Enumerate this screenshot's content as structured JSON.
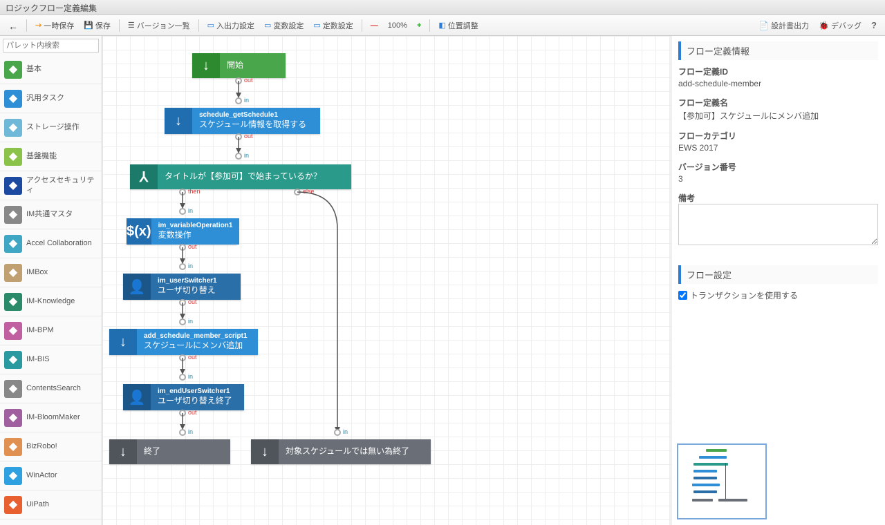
{
  "title": "ロジックフロー定義編集",
  "toolbar": {
    "back": "",
    "temp_save": "一時保存",
    "save": "保存",
    "version_list": "バージョン一覧",
    "io_setting": "入出力設定",
    "var_setting": "変数設定",
    "const_setting": "定数設定",
    "zoom": "100%",
    "align": "位置調整",
    "spec_output": "設計書出力",
    "debug": "デバッグ",
    "help": "?"
  },
  "palette": {
    "search_placeholder": "パレット内検索",
    "items": [
      {
        "label": "基本",
        "color": "#4aa64a"
      },
      {
        "label": "汎用タスク",
        "color": "#2f8fd6"
      },
      {
        "label": "ストレージ操作",
        "color": "#6fb8d8"
      },
      {
        "label": "基盤機能",
        "color": "#8bc34a"
      },
      {
        "label": "アクセスセキュリティ",
        "color": "#1b4aa0"
      },
      {
        "label": "IM共通マスタ",
        "color": "#888"
      },
      {
        "label": "Accel Collaboration",
        "color": "#3fa7c4"
      },
      {
        "label": "IMBox",
        "color": "#c0a070"
      },
      {
        "label": "IM-Knowledge",
        "color": "#2a8a6a"
      },
      {
        "label": "IM-BPM",
        "color": "#c060a0"
      },
      {
        "label": "IM-BIS",
        "color": "#2a9aa0"
      },
      {
        "label": "ContentsSearch",
        "color": "#888"
      },
      {
        "label": "IM-BloomMaker",
        "color": "#a060a0"
      },
      {
        "label": "BizRobo!",
        "color": "#e09050"
      },
      {
        "label": "WinActor",
        "color": "#2fa0e0"
      },
      {
        "label": "UiPath",
        "color": "#e86030"
      }
    ]
  },
  "nodes": {
    "start": {
      "label": "開始",
      "color": "#4aa64a",
      "dark": "#2e8a2e"
    },
    "get_schedule": {
      "id": "schedule_getSchedule1",
      "label": "スケジュール情報を取得する",
      "color": "#2f8fd6",
      "dark": "#206db0"
    },
    "branch": {
      "label": "タイトルが【参加可】で始まっているか？",
      "color": "#2a9a8a",
      "dark": "#1b7a6a"
    },
    "var_op": {
      "id": "im_variableOperation1",
      "label": "変数操作",
      "color": "#2f8fd6",
      "dark": "#206db0"
    },
    "user_switch": {
      "id": "im_userSwitcher1",
      "label": "ユーザ切り替え",
      "color": "#2b6fa8",
      "dark": "#1c5688"
    },
    "add_member": {
      "id": "add_schedule_member_script1",
      "label": "スケジュールにメンバ追加",
      "color": "#2f8fd6",
      "dark": "#206db0"
    },
    "end_switch": {
      "id": "im_endUserSwitcher1",
      "label": "ユーザ切り替え終了",
      "color": "#2b6fa8",
      "dark": "#1c5688"
    },
    "end1": {
      "label": "終了",
      "color": "#6a6f77",
      "dark": "#50555c"
    },
    "end2": {
      "label": "対象スケジュールでは無い為終了",
      "color": "#6a6f77",
      "dark": "#50555c"
    }
  },
  "ports": {
    "in": "in",
    "out": "out",
    "then": "then",
    "else": "else"
  },
  "info": {
    "section1_title": "フロー定義情報",
    "id_label": "フロー定義ID",
    "id_value": "add-schedule-member",
    "name_label": "フロー定義名",
    "name_value": "【参加可】スケジュールにメンバ追加",
    "category_label": "フローカテゴリ",
    "category_value": "EWS 2017",
    "version_label": "バージョン番号",
    "version_value": "3",
    "remarks_label": "備考",
    "section2_title": "フロー設定",
    "transaction": "トランザクションを使用する",
    "transaction_checked": true
  }
}
